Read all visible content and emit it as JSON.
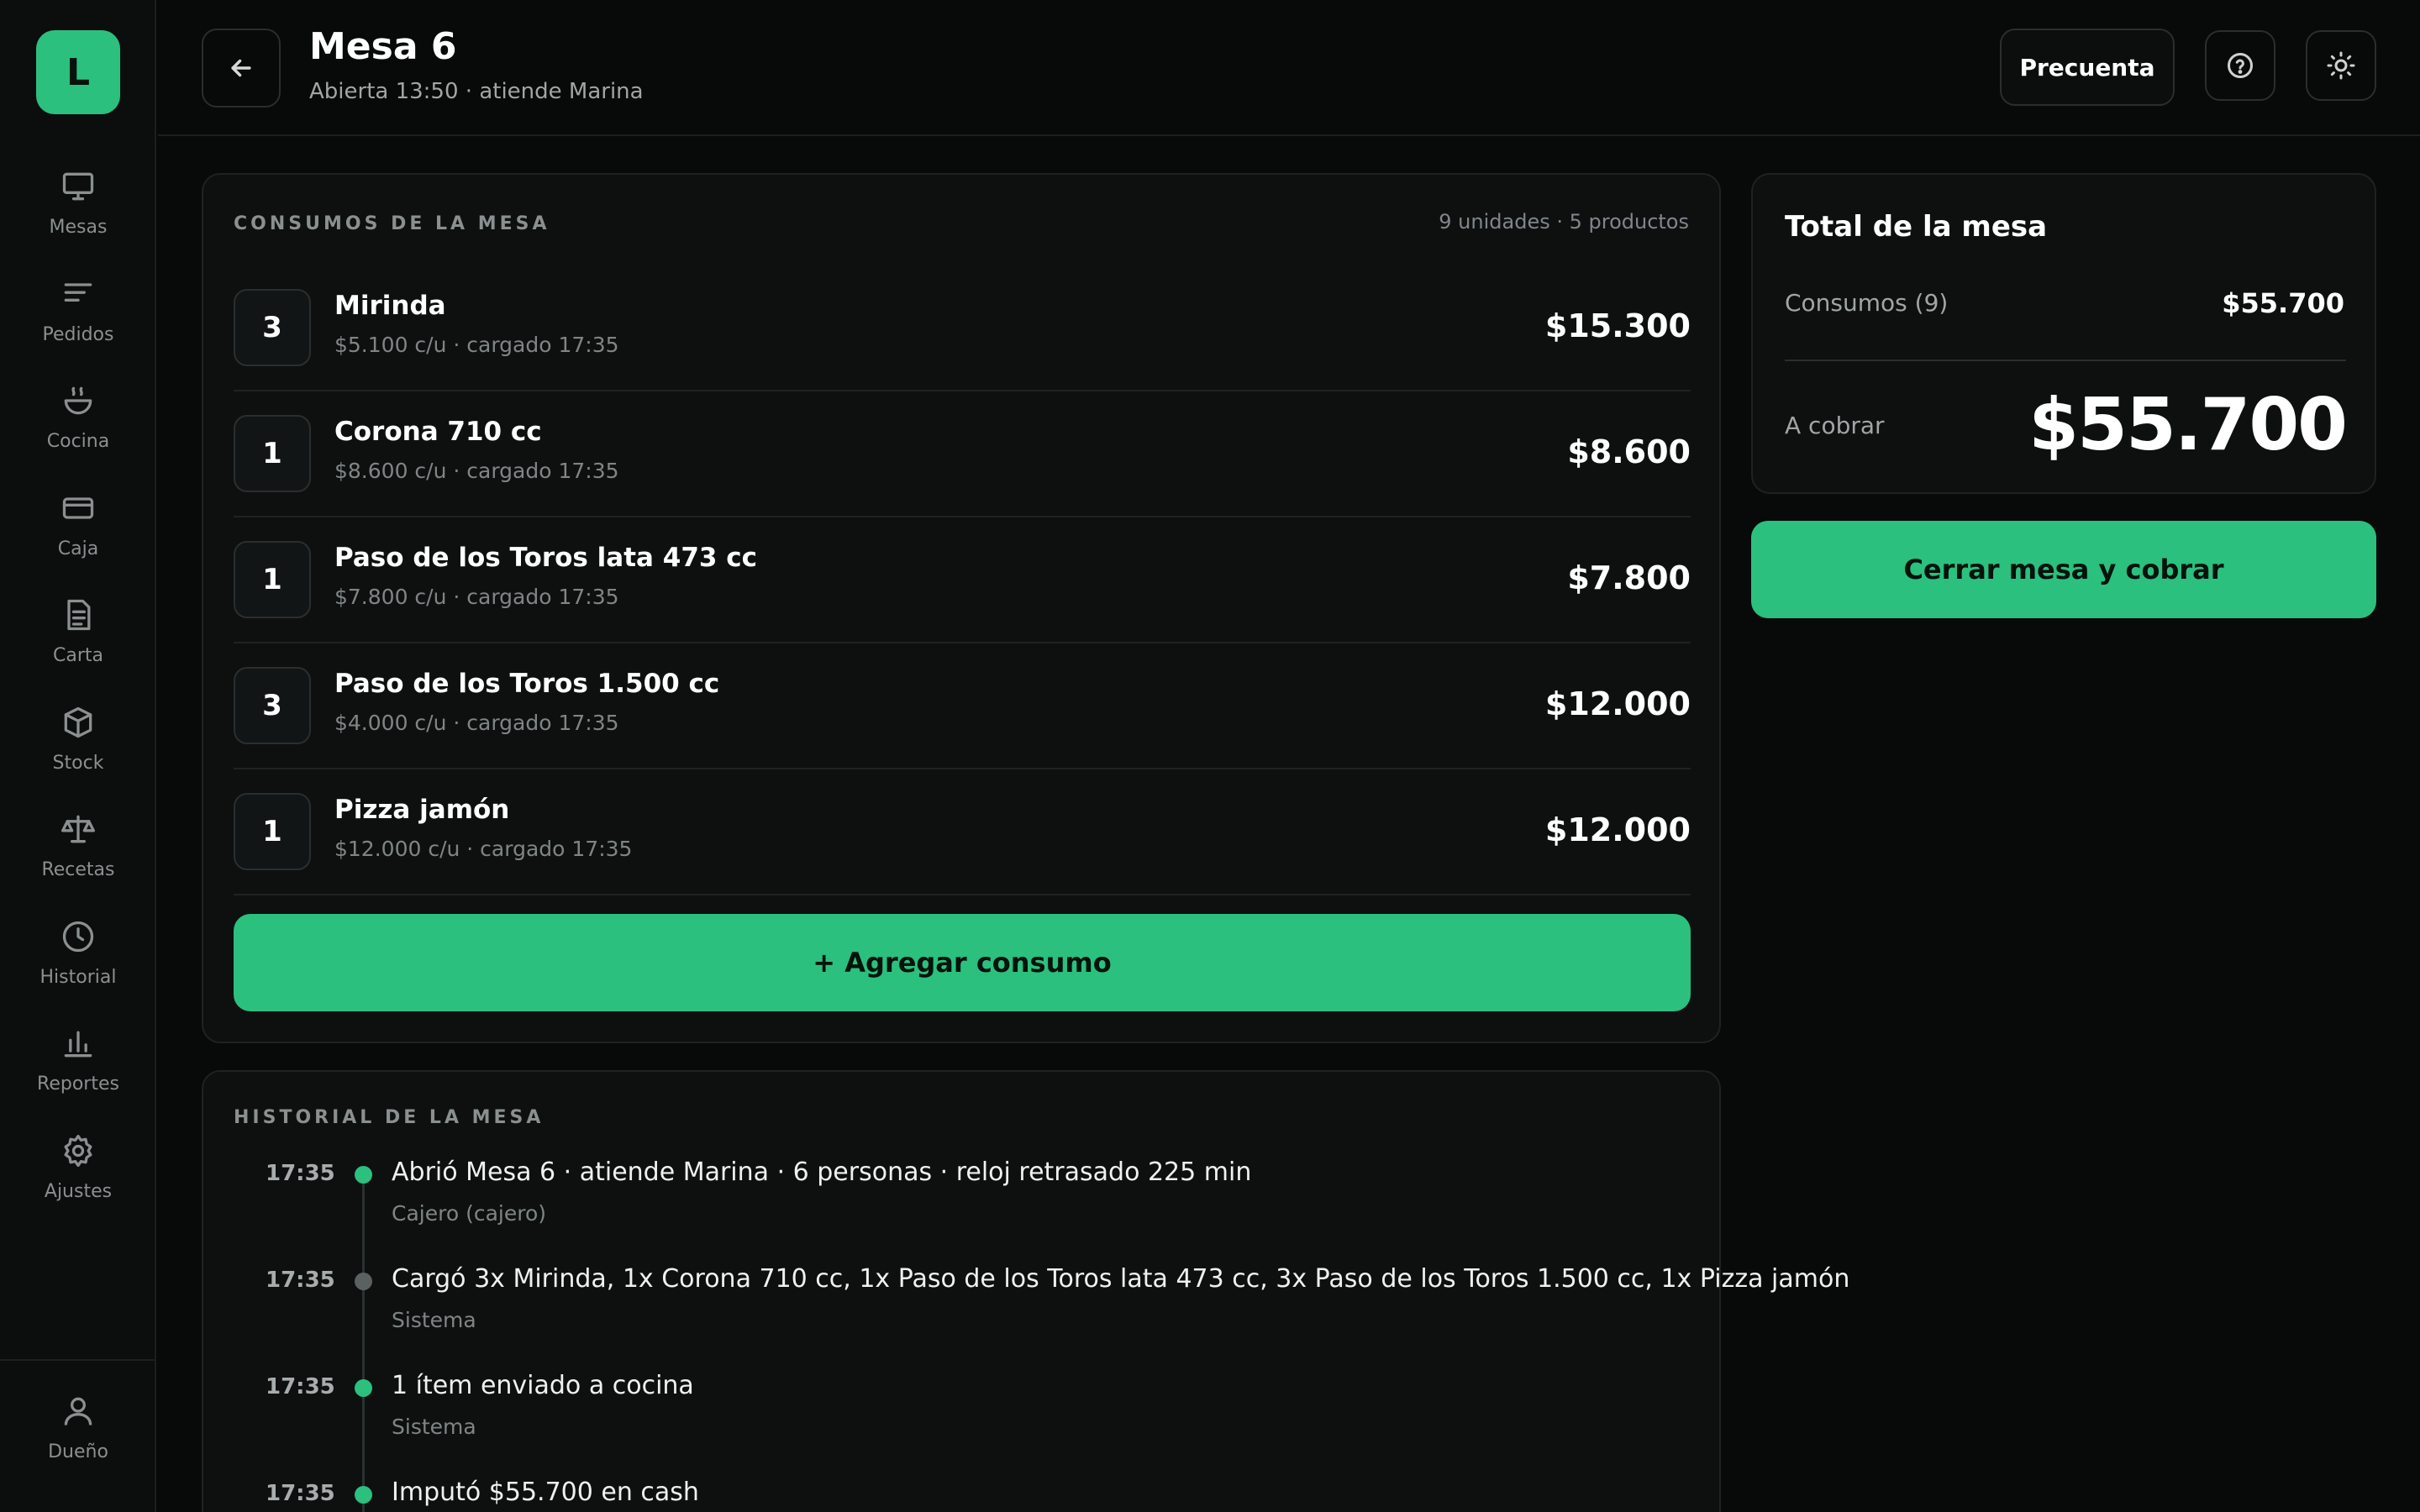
{
  "sidebar": {
    "logo": "L",
    "items": [
      {
        "label": "Mesas",
        "icon": "monitor-icon"
      },
      {
        "label": "Pedidos",
        "icon": "list-icon"
      },
      {
        "label": "Cocina",
        "icon": "bowl-icon"
      },
      {
        "label": "Caja",
        "icon": "card-icon"
      },
      {
        "label": "Carta",
        "icon": "document-icon"
      },
      {
        "label": "Stock",
        "icon": "box-icon"
      },
      {
        "label": "Recetas",
        "icon": "scale-icon"
      },
      {
        "label": "Historial",
        "icon": "clock-icon"
      },
      {
        "label": "Reportes",
        "icon": "bar-chart-icon"
      },
      {
        "label": "Ajustes",
        "icon": "gear-icon"
      }
    ],
    "user": {
      "label": "Dueño",
      "icon": "user-icon"
    }
  },
  "header": {
    "title": "Mesa 6",
    "subtitle": "Abierta 13:50 · atiende Marina",
    "precuenta_label": "Precuenta"
  },
  "consumos": {
    "label": "CONSUMOS DE LA MESA",
    "summary": "9 unidades · 5 productos",
    "items": [
      {
        "qty": "3",
        "name": "Mirinda",
        "meta": "$5.100 c/u · cargado 17:35",
        "total": "$15.300"
      },
      {
        "qty": "1",
        "name": "Corona 710 cc",
        "meta": "$8.600 c/u · cargado 17:35",
        "total": "$8.600"
      },
      {
        "qty": "1",
        "name": "Paso de los Toros lata 473 cc",
        "meta": "$7.800 c/u · cargado 17:35",
        "total": "$7.800"
      },
      {
        "qty": "3",
        "name": "Paso de los Toros 1.500 cc",
        "meta": "$4.000 c/u · cargado 17:35",
        "total": "$12.000"
      },
      {
        "qty": "1",
        "name": "Pizza jamón",
        "meta": "$12.000 c/u · cargado 17:35",
        "total": "$12.000"
      }
    ],
    "add_label": "+ Agregar consumo"
  },
  "historial": {
    "label": "HISTORIAL DE LA MESA",
    "events": [
      {
        "time": "17:35",
        "text": "Abrió Mesa 6 · atiende Marina · 6 personas · reloj retrasado 225 min",
        "actor": "Cajero (cajero)",
        "dot": "#2bc07e"
      },
      {
        "time": "17:35",
        "text": "Cargó 3x Mirinda, 1x Corona 710 cc, 1x Paso de los Toros lata 473 cc, 3x Paso de los Toros 1.500 cc, 1x Pizza jamón",
        "actor": "Sistema",
        "dot": "#5b6060"
      },
      {
        "time": "17:35",
        "text": "1 ítem enviado a cocina",
        "actor": "Sistema",
        "dot": "#2bc07e"
      },
      {
        "time": "17:35",
        "text": "Imputó $55.700 en cash",
        "actor": "",
        "dot": "#2bc07e"
      }
    ]
  },
  "total": {
    "title": "Total de la mesa",
    "consumos_label": "Consumos (9)",
    "consumos_value": "$55.700",
    "cobrar_label": "A cobrar",
    "cobrar_value": "$55.700",
    "close_label": "Cerrar mesa y cobrar"
  },
  "colors": {
    "accent": "#2bc07e",
    "background": "#080909",
    "card": "#0e1010"
  }
}
